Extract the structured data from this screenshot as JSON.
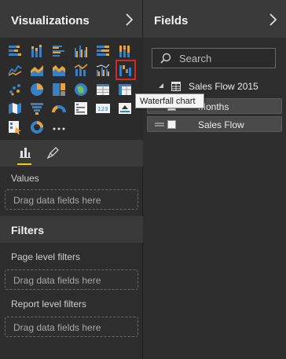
{
  "visualizations": {
    "title": "Visualizations",
    "icons": [
      "stacked-bar-chart-icon",
      "stacked-column-chart-icon",
      "clustered-bar-chart-icon",
      "clustered-column-chart-icon",
      "100-stacked-bar-chart-icon",
      "100-stacked-column-chart-icon",
      "line-chart-icon",
      "area-chart-icon",
      "stacked-area-chart-icon",
      "line-and-stacked-column-chart-icon",
      "line-and-clustered-column-chart-icon",
      "waterfall-chart-icon",
      "scatter-chart-icon",
      "pie-chart-icon",
      "treemap-icon",
      "map-icon",
      "table-icon",
      "matrix-icon",
      "filled-map-icon",
      "funnel-icon",
      "gauge-icon",
      "multi-row-card-icon",
      "card-icon",
      "kpi-icon",
      "slicer-icon",
      "donut-chart-icon",
      "more-icon"
    ],
    "selected_icon": "waterfall-chart-icon",
    "tooltip": "Waterfall chart",
    "tabs": [
      "fields-tab",
      "format-tab"
    ],
    "values_label": "Values",
    "values_drop": "Drag data fields here"
  },
  "filters": {
    "title": "Filters",
    "page_label": "Page level filters",
    "page_drop": "Drag data fields here",
    "report_label": "Report level filters",
    "report_drop": "Drag data fields here"
  },
  "fields": {
    "title": "Fields",
    "search_placeholder": "Search",
    "table_name": "Sales Flow 2015",
    "items": [
      {
        "label": "Months",
        "checked": false
      },
      {
        "label": "Sales Flow",
        "checked": false
      }
    ]
  },
  "colors": {
    "selected_outline": "#d52b1e",
    "active_tab_underline": "#f2c811",
    "icon_blue": "#3a7fc1",
    "icon_orange": "#e8a33a"
  }
}
